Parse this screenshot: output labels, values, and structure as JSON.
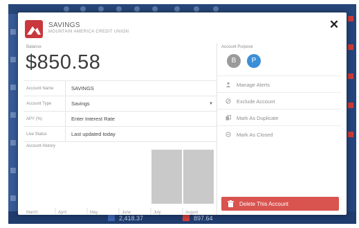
{
  "account": {
    "title": "SAVINGS",
    "institution": "MOUNTAIN AMERICA CREDIT UNION",
    "balance_label": "Balance",
    "balance": "$850.58"
  },
  "fields": [
    {
      "label": "Account Name",
      "value": "SAVINGS"
    },
    {
      "label": "Account Type",
      "value": "Savings"
    },
    {
      "label": "APY (%)",
      "value": "Enter Interest Rate"
    },
    {
      "label": "Live Status",
      "value": "Last updated today"
    }
  ],
  "history_label": "Account History",
  "chart_data": {
    "type": "bar",
    "title": "Account History",
    "categories": [
      "March",
      "April",
      "May",
      "June",
      "July",
      "August"
    ],
    "values": [
      0,
      0,
      0,
      0,
      850.58,
      850.58
    ],
    "grid": false
  },
  "purpose": {
    "label": "Account Purpose",
    "badges": [
      "B",
      "P"
    ],
    "selected": "P"
  },
  "actions": [
    {
      "label": "Manage Alerts",
      "icon": "person-icon"
    },
    {
      "label": "Exclude Account",
      "icon": "exclude-icon"
    },
    {
      "label": "Mark As Duplicate",
      "icon": "duplicate-icon"
    },
    {
      "label": "Mark As Closed",
      "icon": "closed-icon"
    }
  ],
  "delete_label": "Delete This Account",
  "background": {
    "numbers": [
      "2,418.37",
      "897.64"
    ]
  },
  "colors": {
    "brand": "#c8383c",
    "accent": "#3b8fd6",
    "delete": "#d9534f",
    "app_background": "#2a4d8a"
  }
}
